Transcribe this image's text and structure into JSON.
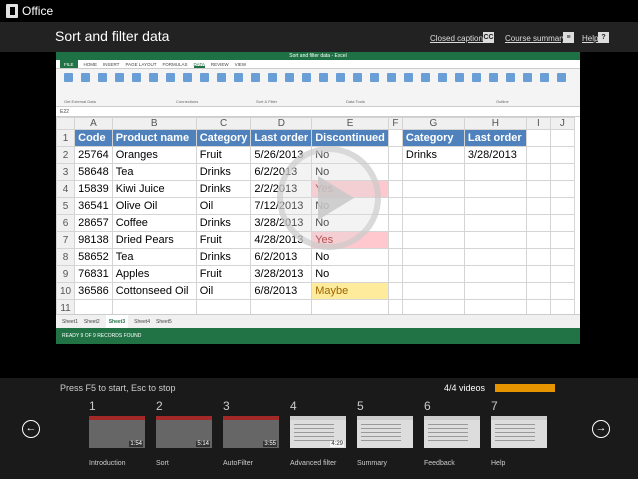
{
  "office_bar": {
    "app_name": "Office"
  },
  "header": {
    "title": "Sort and filter data",
    "closed_captions": "Closed captions",
    "closed_captions_icon": "CC",
    "course_summary": "Course summary",
    "help": "Help",
    "help_icon": "?"
  },
  "excel": {
    "window_title": "Sort and filter data - Excel",
    "tabs": [
      "FILE",
      "HOME",
      "INSERT",
      "PAGE LAYOUT",
      "FORMULAS",
      "DATA",
      "REVIEW",
      "VIEW"
    ],
    "active_tab": "DATA",
    "ribbon_groups": [
      "Get External Data",
      "Connections",
      "Sort & Filter",
      "Data Tools",
      "Outline"
    ],
    "name_box": "E22",
    "columns": [
      "",
      "A",
      "B",
      "C",
      "D",
      "E",
      "F",
      "G",
      "H",
      "I",
      "J"
    ],
    "rows": [
      {
        "n": "1",
        "a": "Code",
        "b": "Product name",
        "c": "Category",
        "d": "Last order",
        "e": "Discontinued",
        "g": "Category",
        "h": "Last order"
      },
      {
        "n": "2",
        "a": "25764",
        "b": "Oranges",
        "c": "Fruit",
        "d": "5/26/2013",
        "e": "No",
        "g": "Drinks",
        "h": "3/28/2013"
      },
      {
        "n": "3",
        "a": "58648",
        "b": "Tea",
        "c": "Drinks",
        "d": "6/2/2013",
        "e": "No",
        "g": "",
        "h": ""
      },
      {
        "n": "4",
        "a": "15839",
        "b": "Kiwi Juice",
        "c": "Drinks",
        "d": "2/2/2013",
        "e": "Yes",
        "g": "",
        "h": ""
      },
      {
        "n": "5",
        "a": "36541",
        "b": "Olive Oil",
        "c": "Oil",
        "d": "7/12/2013",
        "e": "No",
        "g": "",
        "h": ""
      },
      {
        "n": "6",
        "a": "28657",
        "b": "Coffee",
        "c": "Drinks",
        "d": "3/28/2013",
        "e": "No",
        "g": "",
        "h": ""
      },
      {
        "n": "7",
        "a": "98138",
        "b": "Dried Pears",
        "c": "Fruit",
        "d": "4/28/2013",
        "e": "Yes",
        "g": "",
        "h": ""
      },
      {
        "n": "8",
        "a": "58652",
        "b": "Tea",
        "c": "Drinks",
        "d": "6/2/2013",
        "e": "No",
        "g": "",
        "h": ""
      },
      {
        "n": "9",
        "a": "76831",
        "b": "Apples",
        "c": "Fruit",
        "d": "3/28/2013",
        "e": "No",
        "g": "",
        "h": ""
      },
      {
        "n": "10",
        "a": "36586",
        "b": "Cottonseed Oil",
        "c": "Oil",
        "d": "6/8/2013",
        "e": "Maybe",
        "g": "",
        "h": ""
      },
      {
        "n": "11",
        "a": "",
        "b": "",
        "c": "",
        "d": "",
        "e": "",
        "g": "",
        "h": ""
      }
    ],
    "sheet_tabs": [
      "Sheet1",
      "Sheet2",
      "Sheet3",
      "Sheet4",
      "Sheet5"
    ],
    "active_sheet": "Sheet3",
    "status": "READY    9 OF 9 RECORDS FOUND"
  },
  "player": {
    "press_hint": "Press F5 to start, Esc to stop",
    "videos_count": "4/4 videos",
    "progress": 1.0,
    "prev_icon": "←",
    "next_icon": "→"
  },
  "chapters": [
    {
      "num": "1",
      "name": "Introduction",
      "duration": "1:54",
      "style": "dark"
    },
    {
      "num": "2",
      "name": "Sort",
      "duration": "5:14",
      "style": "dark"
    },
    {
      "num": "3",
      "name": "AutoFilter",
      "duration": "3:55",
      "style": "dark"
    },
    {
      "num": "4",
      "name": "Advanced filter",
      "duration": "4:29",
      "style": "light"
    },
    {
      "num": "5",
      "name": "Summary",
      "duration": "",
      "style": "light"
    },
    {
      "num": "6",
      "name": "Feedback",
      "duration": "",
      "style": "light"
    },
    {
      "num": "7",
      "name": "Help",
      "duration": "",
      "style": "light"
    }
  ],
  "colors": {
    "accent": "#e69500",
    "excel_green": "#217346",
    "header_blue": "#4f81bd"
  }
}
